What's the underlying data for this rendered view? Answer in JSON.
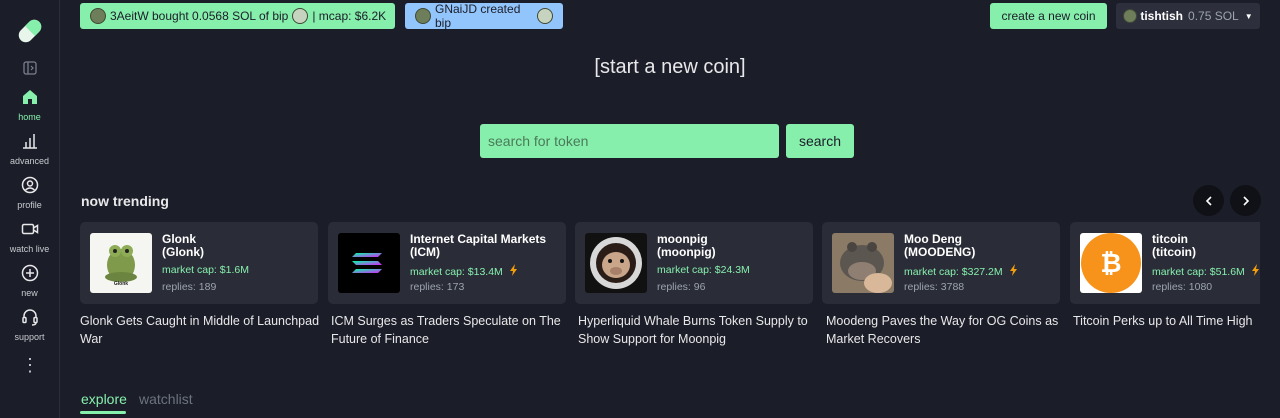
{
  "sidebar": {
    "items": [
      {
        "label": "home",
        "icon": "home-icon",
        "active": true
      },
      {
        "label": "advanced",
        "icon": "bar-chart-icon",
        "active": false
      },
      {
        "label": "profile",
        "icon": "user-circle-icon",
        "active": false
      },
      {
        "label": "watch live",
        "icon": "video-icon",
        "active": false
      },
      {
        "label": "new",
        "icon": "plus-circle-icon",
        "active": false
      },
      {
        "label": "support",
        "icon": "headset-icon",
        "active": false
      }
    ],
    "more": "⋮"
  },
  "ticker": {
    "buy": {
      "text": "3AeitW bought 0.0568 SOL of bip",
      "mcap": "| mcap: $6.2K"
    },
    "create": {
      "text": "GNaiJD created bip"
    }
  },
  "header": {
    "create_coin_label": "create a new coin",
    "username": "tishtish",
    "balance": "0.75 SOL",
    "caret": "▼"
  },
  "main": {
    "title": "[start a new coin]",
    "search": {
      "placeholder": "search for token",
      "button": "search"
    },
    "trending_title": "now trending"
  },
  "trending": [
    {
      "name": "Glonk",
      "ticker": "(Glonk)",
      "mcap": "market cap: $1.6M",
      "replies": "replies: 189",
      "hot": false,
      "headline": "Glonk Gets Caught in Middle of Launchpad War",
      "thumb_caption": "Glonk"
    },
    {
      "name": "Internet Capital Markets",
      "ticker": "(ICM)",
      "mcap": "market cap: $13.4M",
      "replies": "replies: 173",
      "hot": true,
      "headline": "ICM Surges as Traders Speculate on The Future of Finance"
    },
    {
      "name": "moonpig",
      "ticker": "(moonpig)",
      "mcap": "market cap: $24.3M",
      "replies": "replies: 96",
      "hot": false,
      "headline": "Hyperliquid Whale Burns Token Supply to Show Support for Moonpig"
    },
    {
      "name": "Moo Deng",
      "ticker": "(MOODENG)",
      "mcap": "market cap: $327.2M",
      "replies": "replies: 3788",
      "hot": true,
      "headline": "Moodeng Paves the Way for OG Coins as Market Recovers"
    },
    {
      "name": "titcoin",
      "ticker": "(titcoin)",
      "mcap": "market cap: $51.6M",
      "replies": "replies: 1080",
      "hot": true,
      "headline": "Titcoin Perks up to All Time High"
    }
  ],
  "tabs": [
    {
      "label": "explore",
      "active": true
    },
    {
      "label": "watchlist",
      "active": false
    }
  ],
  "colors": {
    "accent": "#86efac",
    "background": "#1b1d28",
    "card": "#2a2d38",
    "info": "#93c5fd"
  }
}
